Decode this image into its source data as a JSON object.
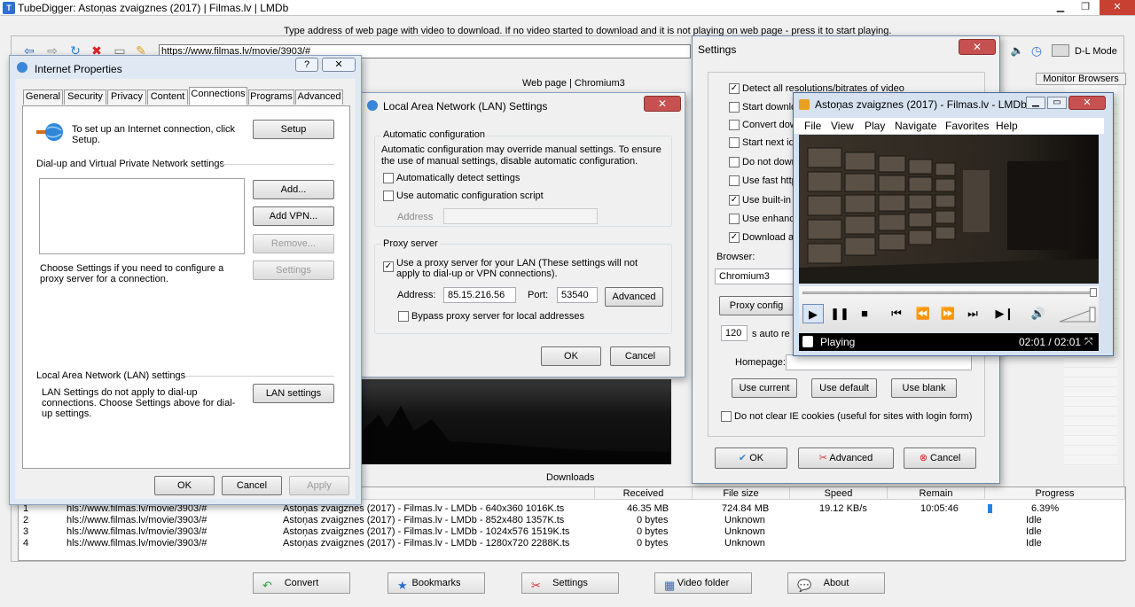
{
  "app": {
    "title": "TubeDigger: Astoņas zvaigznes (2017) | Filmas.lv | LMDb",
    "address_hint": "Type address of web page with video to download. If no video started to download and it is not playing on web page - press it to start playing.",
    "url": "https://www.filmas.lv/movie/3903/#",
    "web_page_label": "Web page | Chromium3",
    "dl_mode": "D-L Mode",
    "monitor_browsers": "Monitor Browsers",
    "downloads_label": "Downloads",
    "icons": [
      "back-arrow-icon",
      "forward-arrow-icon",
      "refresh-icon",
      "stop-icon",
      "page-icon",
      "clean-icon",
      "speaker-icon",
      "clock-icon"
    ]
  },
  "downloads": {
    "headers": [
      "Received",
      "File size",
      "Speed",
      "Remain",
      "Progress"
    ],
    "rows": [
      {
        "n": "1",
        "url": "hls://www.filmas.lv/movie/3903/#",
        "name": "Astoņas zvaigznes (2017) - Filmas.lv - LMDb - 640x360 1016K.ts",
        "received": "46.35 MB",
        "size": "724.84 MB",
        "speed": "19.12 KB/s",
        "remain": "10:05:46",
        "progress": "6.39%",
        "progress_value": 6.39
      },
      {
        "n": "2",
        "url": "hls://www.filmas.lv/movie/3903/#",
        "name": "Astoņas zvaigznes (2017) - Filmas.lv - LMDb - 852x480 1357K.ts",
        "received": "0 bytes",
        "size": "Unknown",
        "speed": "",
        "remain": "",
        "progress": "Idle"
      },
      {
        "n": "3",
        "url": "hls://www.filmas.lv/movie/3903/#",
        "name": "Astoņas zvaigznes (2017) - Filmas.lv - LMDb - 1024x576 1519K.ts",
        "received": "0 bytes",
        "size": "Unknown",
        "speed": "",
        "remain": "",
        "progress": "Idle"
      },
      {
        "n": "4",
        "url": "hls://www.filmas.lv/movie/3903/#",
        "name": "Astoņas zvaigznes (2017) - Filmas.lv - LMDb - 1280x720 2288K.ts",
        "received": "0 bytes",
        "size": "Unknown",
        "speed": "",
        "remain": "",
        "progress": "Idle"
      }
    ]
  },
  "bottom_buttons": {
    "convert": "Convert",
    "bookmarks": "Bookmarks",
    "settings": "Settings",
    "video_folder": "Video folder",
    "about": "About"
  },
  "inet": {
    "title": "Internet Properties",
    "help": "?",
    "tabs": [
      "General",
      "Security",
      "Privacy",
      "Content",
      "Connections",
      "Programs",
      "Advanced"
    ],
    "setup_text": "To set up an Internet connection, click Setup.",
    "setup": "Setup",
    "dialup_group": "Dial-up and Virtual Private Network settings",
    "add": "Add...",
    "add_vpn": "Add VPN...",
    "remove": "Remove...",
    "settings": "Settings",
    "choose_text": "Choose Settings if you need to configure a proxy server for a connection.",
    "lan_group": "Local Area Network (LAN) settings",
    "lan_text": "LAN Settings do not apply to dial-up connections. Choose Settings above for dial-up settings.",
    "lan_settings": "LAN settings",
    "ok": "OK",
    "cancel": "Cancel",
    "apply": "Apply"
  },
  "lan": {
    "title": "Local Area Network (LAN) Settings",
    "auto_group": "Automatic configuration",
    "auto_text": "Automatic configuration may override manual settings.  To ensure the use of manual settings, disable automatic configuration.",
    "auto_detect": "Automatically detect settings",
    "auto_script": "Use automatic configuration script",
    "address_label": "Address",
    "proxy_group": "Proxy server",
    "use_proxy": "Use a proxy server for your LAN (These settings will not apply to dial-up or VPN connections).",
    "addr_label": "Address:",
    "addr_value": "85.15.216.56",
    "port_label": "Port:",
    "port_value": "53540",
    "advanced": "Advanced",
    "bypass": "Bypass proxy server for local addresses",
    "ok": "OK",
    "cancel": "Cancel"
  },
  "settings": {
    "title": "Settings",
    "options": [
      "Detect all resolutions/bitrates of video",
      "Start downlo",
      "Convert dow",
      "Start next id",
      "Do not down",
      "Use fast http",
      "Use built-in r",
      "Use enhance",
      "Download ac"
    ],
    "checked": [
      true,
      false,
      false,
      false,
      false,
      false,
      true,
      false,
      true
    ],
    "browser_label": "Browser:",
    "browser_value": "Chromium3",
    "proxy_config": "Proxy config",
    "auto_value": "120",
    "auto_label": "s  auto re",
    "homepage_label": "Homepage:",
    "use_current": "Use current",
    "use_default": "Use default",
    "use_blank": "Use blank",
    "no_clear": "Do not clear IE cookies (useful for sites with login form)",
    "ok": "OK",
    "advanced": "Advanced",
    "cancel": "Cancel"
  },
  "player": {
    "title": "Astoņas zvaigznes (2017) - Filmas.lv - LMDb ...",
    "menu": [
      "File",
      "View",
      "Play",
      "Navigate",
      "Favorites",
      "Help"
    ],
    "status": "Playing",
    "time": "02:01 / 02:01"
  }
}
